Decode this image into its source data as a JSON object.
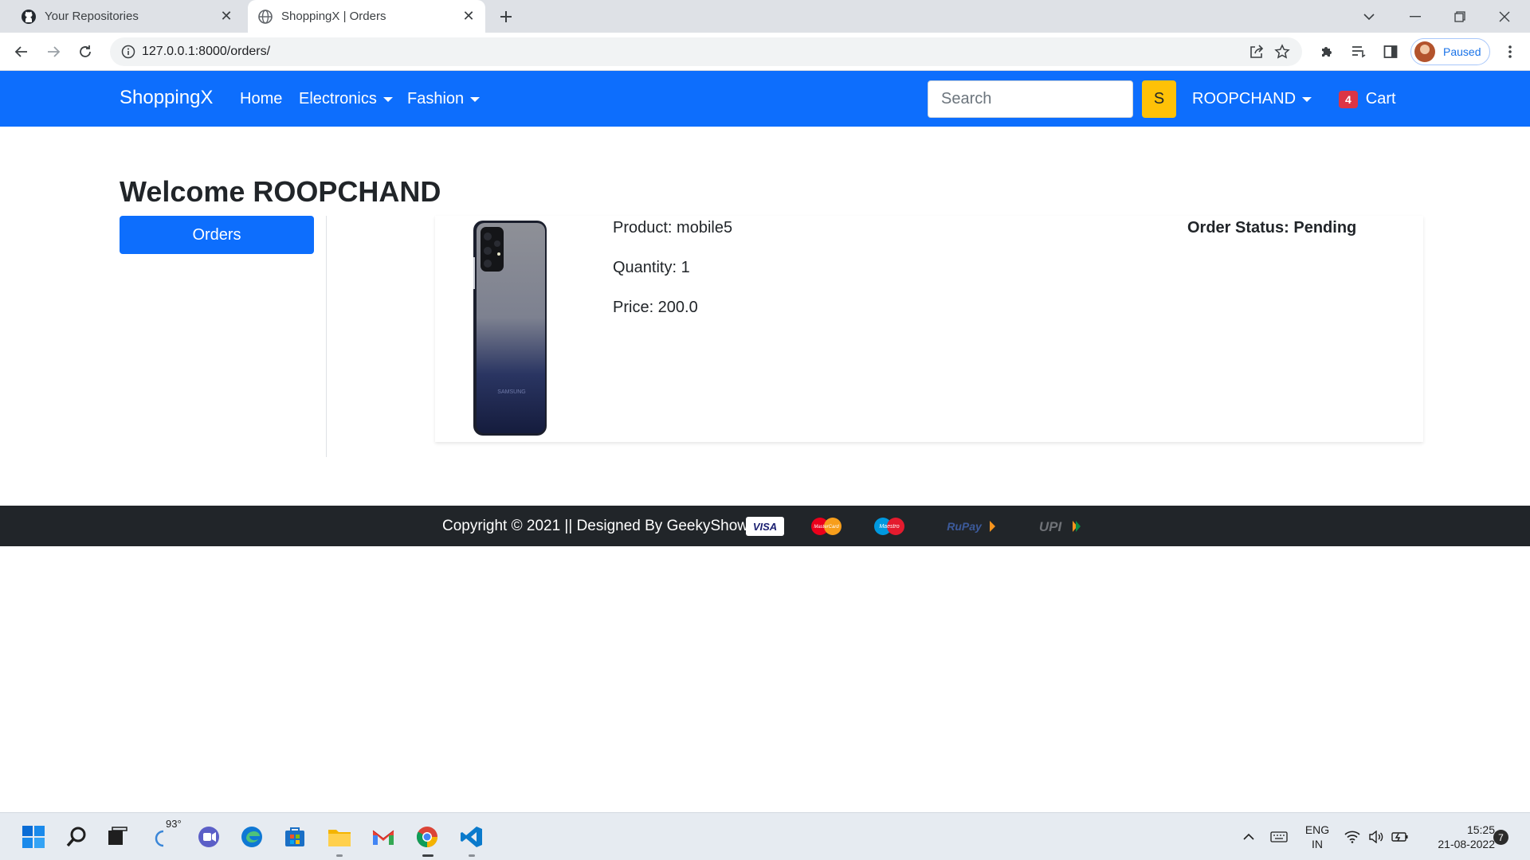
{
  "browser": {
    "tabs": [
      {
        "title": "Your Repositories",
        "active": false,
        "icon": "github-icon"
      },
      {
        "title": "ShoppingX | Orders",
        "active": true,
        "icon": "globe-icon"
      }
    ],
    "url": "127.0.0.1:8000/orders/",
    "profile_label": "Paused"
  },
  "navbar": {
    "brand": "ShoppingX",
    "links": [
      "Home",
      "Electronics",
      "Fashion"
    ],
    "search_placeholder": "Search",
    "search_button": "S",
    "user": "ROOPCHAND",
    "cart_count": "4",
    "cart_label": "Cart",
    "colors": {
      "navbar": "#0d6efd",
      "search_button": "#ffc107",
      "badge": "#dc3545"
    }
  },
  "main": {
    "welcome": "Welcome ROOPCHAND",
    "orders_button": "Orders",
    "order": {
      "product": "Product: mobile5",
      "quantity": "Quantity: 1",
      "price": "Price: 200.0",
      "status": "Order Status: Pending",
      "phone_brand": "SAMSUNG"
    }
  },
  "footer": {
    "text": "Copyright © 2021 || Designed By GeekyShows ||",
    "payments": [
      "VISA",
      "MasterCard",
      "Maestro",
      "RuPay",
      "UPI"
    ]
  },
  "taskbar": {
    "weather": "93°",
    "lang_top": "ENG",
    "lang_bottom": "IN",
    "time": "15:25",
    "date": "21-08-2022",
    "notifications": "7"
  }
}
